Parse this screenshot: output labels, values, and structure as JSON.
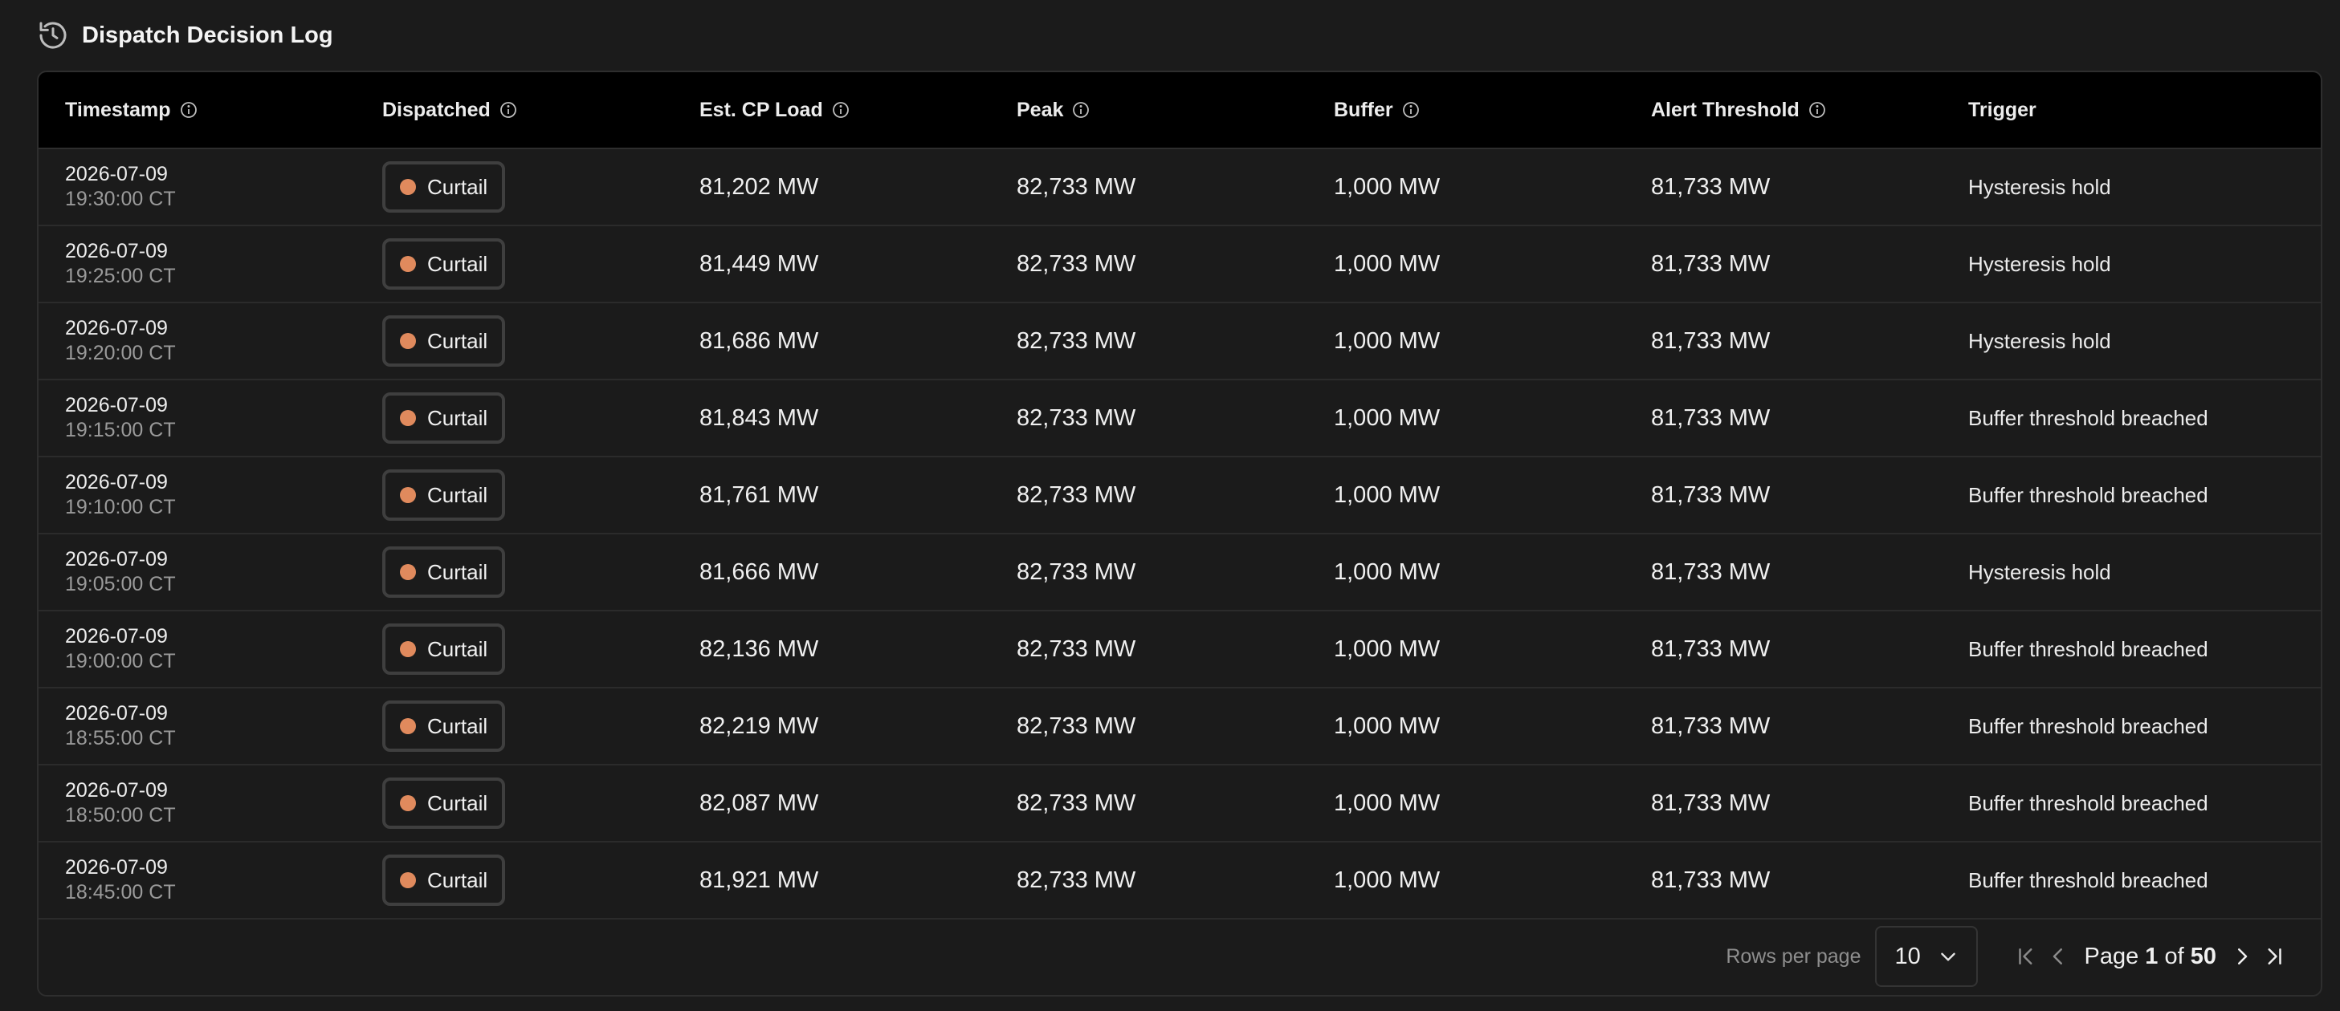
{
  "title": "Dispatch Decision Log",
  "icons": {
    "header": "history-icon",
    "info": "info-icon",
    "first": "first-page-icon",
    "prev": "prev-page-icon",
    "next": "next-page-icon",
    "last": "last-page-icon",
    "chevron": "chevron-down-icon"
  },
  "colors": {
    "accent_dot": "#e08a5d",
    "header_bg": "#000000",
    "page_bg": "#1b1b1b"
  },
  "columns": [
    "Timestamp",
    "Dispatched",
    "Est. CP Load",
    "Peak",
    "Buffer",
    "Alert Threshold",
    "Trigger"
  ],
  "rows": [
    {
      "date": "2026-07-09",
      "time": "19:30:00 CT",
      "dispatched": "Curtail",
      "load": "81,202 MW",
      "peak": "82,733 MW",
      "buffer": "1,000 MW",
      "threshold": "81,733 MW",
      "trigger": "Hysteresis hold"
    },
    {
      "date": "2026-07-09",
      "time": "19:25:00 CT",
      "dispatched": "Curtail",
      "load": "81,449 MW",
      "peak": "82,733 MW",
      "buffer": "1,000 MW",
      "threshold": "81,733 MW",
      "trigger": "Hysteresis hold"
    },
    {
      "date": "2026-07-09",
      "time": "19:20:00 CT",
      "dispatched": "Curtail",
      "load": "81,686 MW",
      "peak": "82,733 MW",
      "buffer": "1,000 MW",
      "threshold": "81,733 MW",
      "trigger": "Hysteresis hold"
    },
    {
      "date": "2026-07-09",
      "time": "19:15:00 CT",
      "dispatched": "Curtail",
      "load": "81,843 MW",
      "peak": "82,733 MW",
      "buffer": "1,000 MW",
      "threshold": "81,733 MW",
      "trigger": "Buffer threshold breached"
    },
    {
      "date": "2026-07-09",
      "time": "19:10:00 CT",
      "dispatched": "Curtail",
      "load": "81,761 MW",
      "peak": "82,733 MW",
      "buffer": "1,000 MW",
      "threshold": "81,733 MW",
      "trigger": "Buffer threshold breached"
    },
    {
      "date": "2026-07-09",
      "time": "19:05:00 CT",
      "dispatched": "Curtail",
      "load": "81,666 MW",
      "peak": "82,733 MW",
      "buffer": "1,000 MW",
      "threshold": "81,733 MW",
      "trigger": "Hysteresis hold"
    },
    {
      "date": "2026-07-09",
      "time": "19:00:00 CT",
      "dispatched": "Curtail",
      "load": "82,136 MW",
      "peak": "82,733 MW",
      "buffer": "1,000 MW",
      "threshold": "81,733 MW",
      "trigger": "Buffer threshold breached"
    },
    {
      "date": "2026-07-09",
      "time": "18:55:00 CT",
      "dispatched": "Curtail",
      "load": "82,219 MW",
      "peak": "82,733 MW",
      "buffer": "1,000 MW",
      "threshold": "81,733 MW",
      "trigger": "Buffer threshold breached"
    },
    {
      "date": "2026-07-09",
      "time": "18:50:00 CT",
      "dispatched": "Curtail",
      "load": "82,087 MW",
      "peak": "82,733 MW",
      "buffer": "1,000 MW",
      "threshold": "81,733 MW",
      "trigger": "Buffer threshold breached"
    },
    {
      "date": "2026-07-09",
      "time": "18:45:00 CT",
      "dispatched": "Curtail",
      "load": "81,921 MW",
      "peak": "82,733 MW",
      "buffer": "1,000 MW",
      "threshold": "81,733 MW",
      "trigger": "Buffer threshold breached"
    }
  ],
  "pagination": {
    "rows_per_page_label": "Rows per page",
    "rows_per_page": "10",
    "page_word": "Page",
    "current": "1",
    "of_word": "of",
    "total": "50"
  }
}
